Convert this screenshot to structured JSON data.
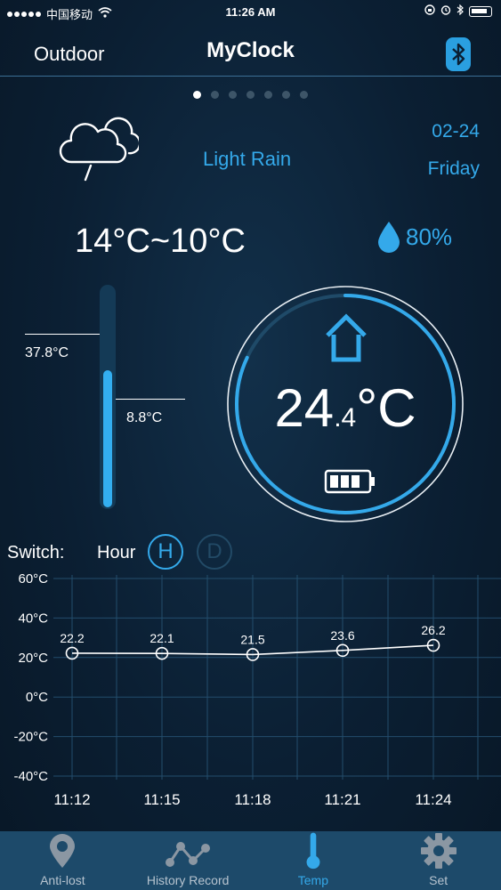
{
  "status_bar": {
    "carrier": "中国移动",
    "time": "11:26 AM"
  },
  "header": {
    "outdoor_tab": "Outdoor",
    "title": "MyClock",
    "bluetooth_icon": "bluetooth-icon"
  },
  "pager": {
    "count": 7,
    "active_index": 0
  },
  "weather": {
    "icon": "cloud-rain-icon",
    "description": "Light Rain",
    "date": "02-24",
    "day": "Friday",
    "temp_range": "14°C~10°C",
    "humidity": "80%",
    "humidity_icon": "water-drop-icon"
  },
  "thermometer": {
    "max_label": "37.8°C",
    "min_label": "8.8°C",
    "fill_fraction": 0.62
  },
  "indoor": {
    "icon": "home-icon",
    "temp_int": "24",
    "temp_dec": ".4",
    "unit": "°C",
    "battery_icon": "battery-icon",
    "ring_progress": 0.82
  },
  "switch": {
    "label": "Switch:",
    "mode": "Hour",
    "hour_button": "H",
    "day_button": "D"
  },
  "chart_data": {
    "type": "line",
    "x": [
      "11:12",
      "11:15",
      "11:18",
      "11:21",
      "11:24"
    ],
    "series": [
      {
        "values": [
          22.2,
          22.1,
          21.5,
          23.6,
          26.2
        ],
        "labels": [
          "22.2",
          "22.1",
          "21.5",
          "23.6",
          "26.2"
        ]
      }
    ],
    "yticks": [
      "60°C",
      "40°C",
      "20°C",
      "0°C",
      "-20°C",
      "-40°C"
    ],
    "ytick_values": [
      60,
      40,
      20,
      0,
      -20,
      -40
    ],
    "ylim": [
      -40,
      60
    ],
    "grid": true
  },
  "colors": {
    "accent": "#34a9ea",
    "tab_bar": "#1d4a6a",
    "background": "#0b1f33"
  },
  "tab_bar": {
    "items": [
      {
        "label": "Anti-lost",
        "icon": "location-pin-icon"
      },
      {
        "label": "History Record",
        "icon": "line-graph-icon"
      },
      {
        "label": "Temp",
        "icon": "thermometer-icon"
      },
      {
        "label": "Set",
        "icon": "gear-icon"
      }
    ],
    "active_index": 2
  }
}
